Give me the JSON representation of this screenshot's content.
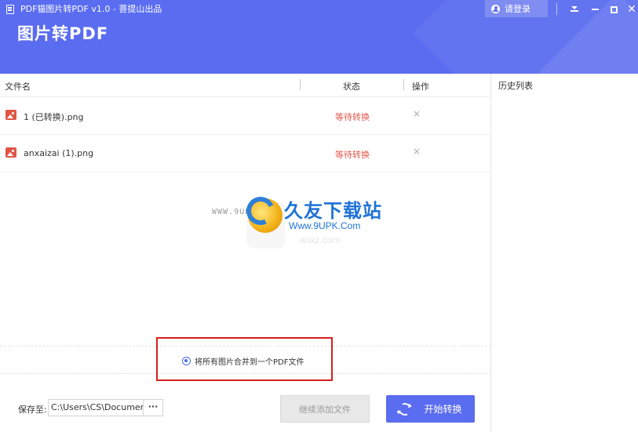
{
  "window": {
    "title": "PDF猫图片转PDF v1.0 - 菩提山出品",
    "app_title": "图片转PDF",
    "login_label": "请登录",
    "accent_color": "#5a6cf0"
  },
  "table": {
    "headers": {
      "name": "文件名",
      "status": "状态",
      "action": "操作"
    },
    "rows": [
      {
        "name": "1 (已转换).png",
        "status": "等待转换",
        "remove": "×",
        "icon": "image-file-icon"
      },
      {
        "name": "anxaizai (1).png",
        "status": "等待转换",
        "remove": "×",
        "icon": "image-file-icon"
      }
    ]
  },
  "watermark": {
    "left_text": "WWW.9UPK.COM",
    "title": "久友下载站",
    "url": "Www.9UPK.Com",
    "url2": "anxz.com"
  },
  "merge_option": {
    "label": "将所有图片合并到一个PDF文件",
    "selected": true
  },
  "footer": {
    "save_label": "保存至:",
    "save_path": "C:\\Users\\CS\\Documents",
    "browse_label": "···",
    "add_button": "继续添加文件",
    "start_button": "开始转换"
  },
  "history": {
    "title": "历史列表"
  },
  "colors": {
    "status_waiting": "#e2574c",
    "highlight": "#d71f1f"
  }
}
